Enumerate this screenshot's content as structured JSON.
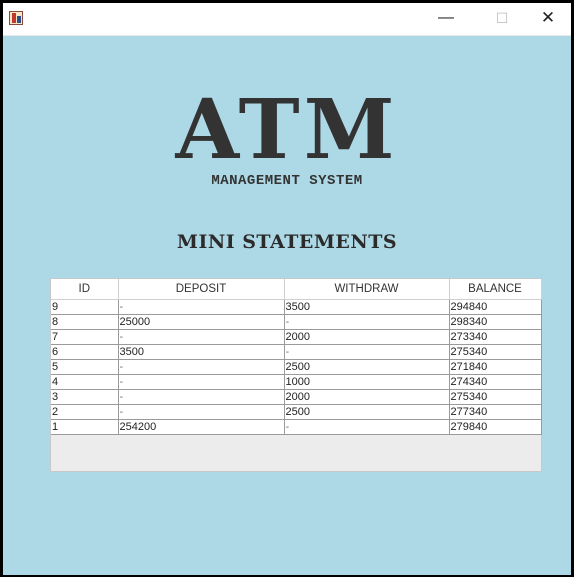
{
  "window": {
    "minimize_glyph": "—",
    "maximize_glyph": "☐",
    "close_glyph": "✕"
  },
  "logo": {
    "title": "ATM",
    "subtitle": "MANAGEMENT SYSTEM"
  },
  "heading": "MINI STATEMENTS",
  "table": {
    "columns": [
      "ID",
      "DEPOSIT",
      "WITHDRAW",
      "BALANCE"
    ],
    "rows": [
      [
        "9",
        "-",
        "3500",
        "294840"
      ],
      [
        "8",
        "25000",
        "-",
        "298340"
      ],
      [
        "7",
        "-",
        "2000",
        "273340"
      ],
      [
        "6",
        "3500",
        "-",
        "275340"
      ],
      [
        "5",
        "-",
        "2500",
        "271840"
      ],
      [
        "4",
        "-",
        "1000",
        "274340"
      ],
      [
        "3",
        "-",
        "2000",
        "275340"
      ],
      [
        "2",
        "-",
        "2500",
        "277340"
      ],
      [
        "1",
        "254200",
        "-",
        "279840"
      ]
    ]
  },
  "colors": {
    "background": "#add8e6",
    "text": "#333333"
  }
}
